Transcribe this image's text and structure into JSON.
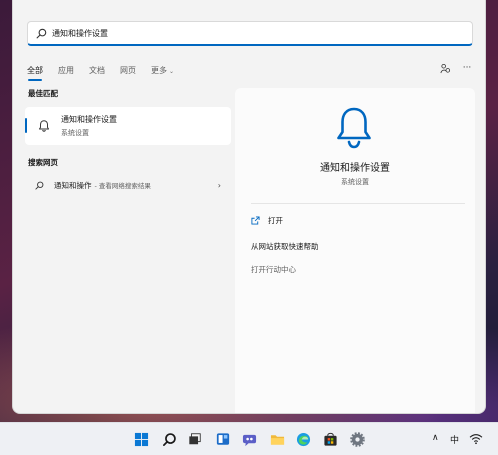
{
  "search": {
    "value": "通知和操作设置",
    "placeholder": ""
  },
  "tabs": [
    {
      "label": "全部"
    },
    {
      "label": "应用"
    },
    {
      "label": "文档"
    },
    {
      "label": "网页"
    },
    {
      "label": "更多"
    }
  ],
  "more_chevron": "⌄",
  "top_icons": [
    "share-icon",
    "more-options-icon"
  ],
  "more_options_glyph": "···",
  "left": {
    "best_match_title": "最佳匹配",
    "best_match": {
      "title": "通知和操作设置",
      "subtitle": "系统设置",
      "icon": "bell-icon"
    },
    "web_title": "搜索网页",
    "web_result": {
      "title": "通知和操作",
      "suffix": "- 查看网络搜索结果",
      "icon": "search-icon",
      "arrow": "›"
    }
  },
  "right": {
    "icon": "bell-icon",
    "title": "通知和操作设置",
    "subtitle": "系统设置",
    "actions": [
      {
        "label": "打开",
        "icon": "open-icon"
      },
      {
        "label": "从网站获取快速帮助"
      },
      {
        "label": "打开行动中心"
      }
    ]
  },
  "taskbar": {
    "icons": [
      "start-icon",
      "search-icon",
      "task-view-icon",
      "widgets-icon",
      "chat-icon",
      "file-explorer-icon",
      "edge-icon",
      "store-icon",
      "settings-icon"
    ],
    "tray": {
      "chevron": "∧",
      "ime": "中",
      "network": "wifi-icon"
    }
  },
  "colors": {
    "accent": "#0067c0",
    "panel_bg": "#f3f3f3"
  }
}
